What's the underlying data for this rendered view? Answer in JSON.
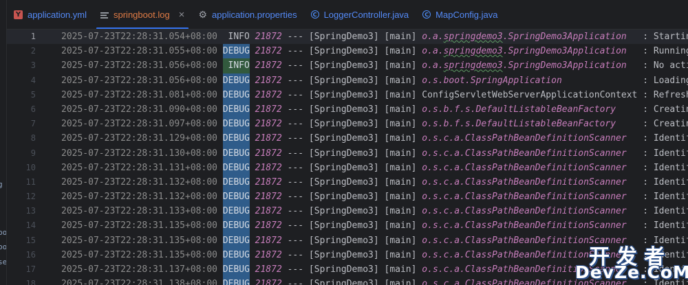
{
  "tabs": [
    {
      "label": "application.yml",
      "icon": "yml-file-icon",
      "active": false
    },
    {
      "label": "springboot.log",
      "icon": "log-file-icon",
      "active": true
    },
    {
      "label": "application.properties",
      "icon": "properties-file-icon",
      "active": false
    },
    {
      "label": "LoggerController.java",
      "icon": "java-class-icon",
      "active": false
    },
    {
      "label": "MapConfig.java",
      "icon": "java-class-icon",
      "active": false
    }
  ],
  "close_glyph": "×",
  "left_strip_fragments": [
    "g",
    "po",
    "po",
    "se"
  ],
  "current_line": 1,
  "log_lines": [
    {
      "n": "1",
      "ts": "2025-07-23T22:28:31.054+08:00",
      "level": "INFO",
      "pid": "21872",
      "sep": "---",
      "app": "[SpringDemo3]",
      "thread": "[main]",
      "logger": "o.a.springdemo3.SpringDemo3Application",
      "msg": ": Starting"
    },
    {
      "n": "2",
      "ts": "2025-07-23T22:28:31.055+08:00",
      "level": "DEBUG",
      "pid": "21872",
      "sep": "---",
      "app": "[SpringDemo3]",
      "thread": "[main]",
      "logger": "o.a.springdemo3.SpringDemo3Application",
      "msg": ": Running w"
    },
    {
      "n": "3",
      "ts": "2025-07-23T22:28:31.056+08:00",
      "level": "INFO",
      "pid": "21872",
      "sep": "---",
      "app": "[SpringDemo3]",
      "thread": "[main]",
      "logger": "o.a.springdemo3.SpringDemo3Application",
      "msg": ": No activ"
    },
    {
      "n": "4",
      "ts": "2025-07-23T22:28:31.056+08:00",
      "level": "DEBUG",
      "pid": "21872",
      "sep": "---",
      "app": "[SpringDemo3]",
      "thread": "[main]",
      "logger": "o.s.boot.SpringApplication",
      "msg": ": Loading s"
    },
    {
      "n": "5",
      "ts": "2025-07-23T22:28:31.081+08:00",
      "level": "DEBUG",
      "pid": "21872",
      "sep": "---",
      "app": "[SpringDemo3]",
      "thread": "[main]",
      "logger": "ConfigServletWebServerApplicationContext",
      "msg": ": Refreshi"
    },
    {
      "n": "6",
      "ts": "2025-07-23T22:28:31.090+08:00",
      "level": "DEBUG",
      "pid": "21872",
      "sep": "---",
      "app": "[SpringDemo3]",
      "thread": "[main]",
      "logger": "o.s.b.f.s.DefaultListableBeanFactory",
      "msg": ": Creating"
    },
    {
      "n": "7",
      "ts": "2025-07-23T22:28:31.097+08:00",
      "level": "DEBUG",
      "pid": "21872",
      "sep": "---",
      "app": "[SpringDemo3]",
      "thread": "[main]",
      "logger": "o.s.b.f.s.DefaultListableBeanFactory",
      "msg": ": Creating"
    },
    {
      "n": "8",
      "ts": "2025-07-23T22:28:31.129+08:00",
      "level": "DEBUG",
      "pid": "21872",
      "sep": "---",
      "app": "[SpringDemo3]",
      "thread": "[main]",
      "logger": "o.s.c.a.ClassPathBeanDefinitionScanner",
      "msg": ": Identifi"
    },
    {
      "n": "9",
      "ts": "2025-07-23T22:28:31.130+08:00",
      "level": "DEBUG",
      "pid": "21872",
      "sep": "---",
      "app": "[SpringDemo3]",
      "thread": "[main]",
      "logger": "o.s.c.a.ClassPathBeanDefinitionScanner",
      "msg": ": Identifi"
    },
    {
      "n": "10",
      "ts": "2025-07-23T22:28:31.131+08:00",
      "level": "DEBUG",
      "pid": "21872",
      "sep": "---",
      "app": "[SpringDemo3]",
      "thread": "[main]",
      "logger": "o.s.c.a.ClassPathBeanDefinitionScanner",
      "msg": ": Identifi"
    },
    {
      "n": "11",
      "ts": "2025-07-23T22:28:31.132+08:00",
      "level": "DEBUG",
      "pid": "21872",
      "sep": "---",
      "app": "[SpringDemo3]",
      "thread": "[main]",
      "logger": "o.s.c.a.ClassPathBeanDefinitionScanner",
      "msg": ": Identifi"
    },
    {
      "n": "12",
      "ts": "2025-07-23T22:28:31.132+08:00",
      "level": "DEBUG",
      "pid": "21872",
      "sep": "---",
      "app": "[SpringDemo3]",
      "thread": "[main]",
      "logger": "o.s.c.a.ClassPathBeanDefinitionScanner",
      "msg": ": Identifi"
    },
    {
      "n": "13",
      "ts": "2025-07-23T22:28:31.133+08:00",
      "level": "DEBUG",
      "pid": "21872",
      "sep": "---",
      "app": "[SpringDemo3]",
      "thread": "[main]",
      "logger": "o.s.c.a.ClassPathBeanDefinitionScanner",
      "msg": ": Identifi"
    },
    {
      "n": "14",
      "ts": "2025-07-23T22:28:31.135+08:00",
      "level": "DEBUG",
      "pid": "21872",
      "sep": "---",
      "app": "[SpringDemo3]",
      "thread": "[main]",
      "logger": "o.s.c.a.ClassPathBeanDefinitionScanner",
      "msg": ": Identifi"
    },
    {
      "n": "15",
      "ts": "2025-07-23T22:28:31.135+08:00",
      "level": "DEBUG",
      "pid": "21872",
      "sep": "---",
      "app": "[SpringDemo3]",
      "thread": "[main]",
      "logger": "o.s.c.a.ClassPathBeanDefinitionScanner",
      "msg": ": Identifi"
    },
    {
      "n": "16",
      "ts": "2025-07-23T22:28:31.135+08:00",
      "level": "DEBUG",
      "pid": "21872",
      "sep": "---",
      "app": "[SpringDemo3]",
      "thread": "[main]",
      "logger": "o.s.c.a.ClassPathBeanDefinitionScanner",
      "msg": ": Identifi"
    },
    {
      "n": "17",
      "ts": "2025-07-23T22:28:31.137+08:00",
      "level": "DEBUG",
      "pid": "21872",
      "sep": "---",
      "app": "[SpringDemo3]",
      "thread": "[main]",
      "logger": "o.s.c.a.ClassPathBeanDefinitionScanner",
      "msg": ": Identifi"
    },
    {
      "n": "18",
      "ts": "2025-07-23T22:28:31.138+08:00",
      "level": "DEBUG",
      "pid": "21872",
      "sep": "---",
      "app": "[SpringDemo3]",
      "thread": "[main]",
      "logger": "o.s.c.a.ClassPathBeanDefinitionScanner",
      "msg": ": Identifi"
    }
  ],
  "highlight_line": 3,
  "watermark": {
    "cn": "开发者",
    "en": "DevZe.CoM"
  },
  "colors": {
    "background": "#1e1f22",
    "debug_highlight": "#2f5c8a",
    "info_highlight": "#32593d",
    "logger_italic": "#c77dbb",
    "active_tab_text": "#e07b45",
    "tab_text": "#548af7"
  }
}
